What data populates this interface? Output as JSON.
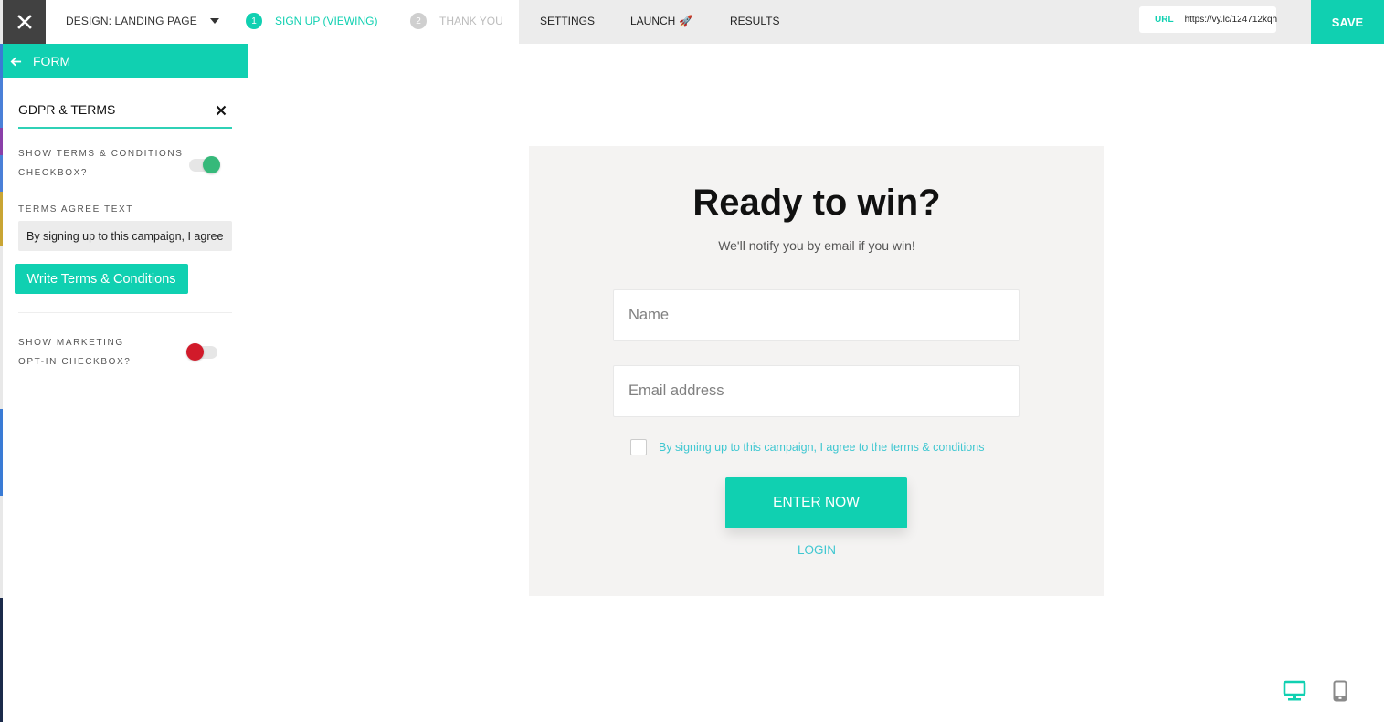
{
  "topbar": {
    "design_label": "DESIGN: LANDING PAGE",
    "steps": [
      {
        "number": "1",
        "label": "SIGN UP (VIEWING)",
        "active": true
      },
      {
        "number": "2",
        "label": "THANK YOU",
        "active": false
      }
    ],
    "nav": {
      "settings": "SETTINGS",
      "launch": "LAUNCH",
      "launch_emoji": "🚀",
      "results": "RESULTS"
    },
    "url_label": "URL",
    "url_value": "https://vy.lc/124712kqh",
    "save_label": "SAVE"
  },
  "panel": {
    "back_label": "FORM",
    "section_title": "GDPR & TERMS",
    "terms_toggle_label_line1": "SHOW TERMS & CONDITIONS",
    "terms_toggle_label_line2": "CHECKBOX?",
    "terms_toggle_on": true,
    "terms_agree_label": "TERMS AGREE TEXT",
    "terms_agree_value": "By signing up to this campaign, I agree to the terms & conditions",
    "write_terms_button": "Write Terms & Conditions",
    "marketing_toggle_label_line1": "SHOW MARKETING",
    "marketing_toggle_label_line2": "OPT-IN CHECKBOX?",
    "marketing_toggle_on": false
  },
  "preview": {
    "title": "Ready to win?",
    "subtitle": "We'll notify you by email if you win!",
    "name_placeholder": "Name",
    "email_placeholder": "Email address",
    "terms_text": "By signing up to this campaign, I agree to the terms & conditions",
    "enter_button": "ENTER NOW",
    "login_link": "LOGIN"
  },
  "device_switch": {
    "active": "desktop",
    "options": [
      "desktop",
      "mobile"
    ]
  },
  "colors": {
    "accent": "#10d0b1",
    "link": "#3fc7d1",
    "toggle_on": "#36b97a",
    "toggle_off": "#d11a2a",
    "close_bg": "#414141"
  }
}
